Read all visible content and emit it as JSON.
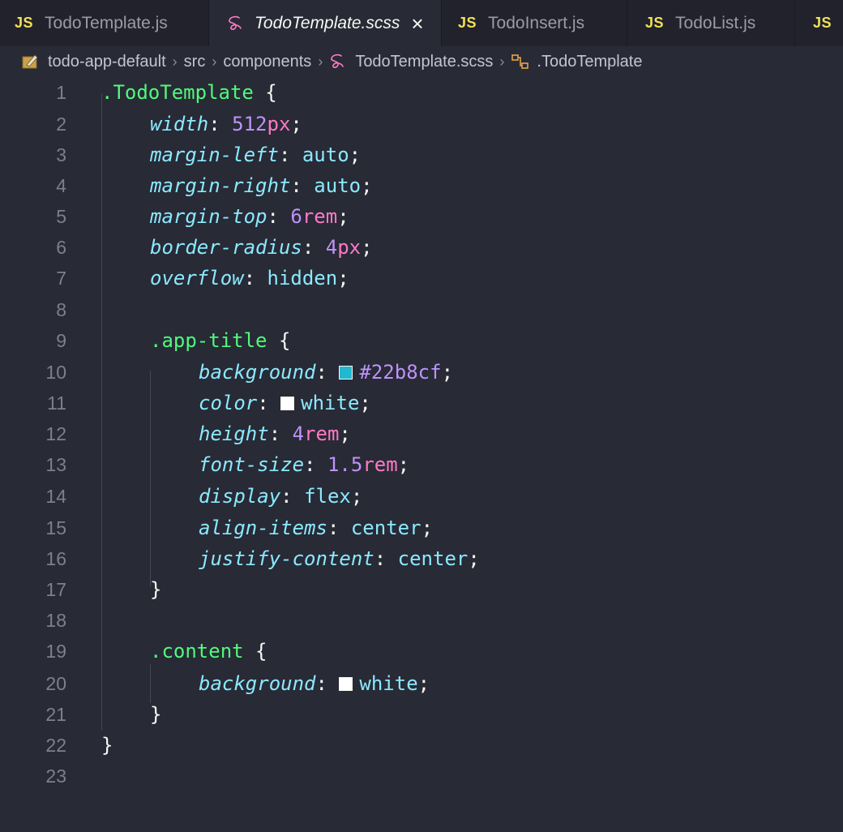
{
  "tabs": [
    {
      "kind": "js",
      "badge": "JS",
      "label": "TodoTemplate.js"
    },
    {
      "kind": "scss",
      "label": "TodoTemplate.scss",
      "close": "×"
    },
    {
      "kind": "js",
      "badge": "JS",
      "label": "TodoInsert.js"
    },
    {
      "kind": "js",
      "badge": "JS",
      "label": "TodoList.js"
    },
    {
      "kind": "js",
      "badge": "JS",
      "label": ""
    }
  ],
  "breadcrumb": [
    "todo-app-default",
    "src",
    "components",
    "TodoTemplate.scss",
    ".TodoTemplate"
  ],
  "colors": {
    "app_title_bg": "#22b8cf",
    "white": "#ffffff"
  },
  "editor": {
    "line_numbers": [
      "1",
      "2",
      "3",
      "4",
      "5",
      "6",
      "7",
      "8",
      "9",
      "10",
      "11",
      "12",
      "13",
      "14",
      "15",
      "16",
      "17",
      "18",
      "19",
      "20",
      "21",
      "22",
      "23"
    ],
    "lines": [
      ".TodoTemplate {",
      "    width: 512px;",
      "    margin-left: auto;",
      "    margin-right: auto;",
      "    margin-top: 6rem;",
      "    border-radius: 4px;",
      "    overflow: hidden;",
      "",
      "    .app-title {",
      "        background: #22b8cf;",
      "        color: white;",
      "        height: 4rem;",
      "        font-size: 1.5rem;",
      "        display: flex;",
      "        align-items: center;",
      "        justify-content: center;",
      "    }",
      "",
      "    .content {",
      "        background: white;",
      "    }",
      "}",
      ""
    ],
    "tokens": {
      "sel_root": ".TodoTemplate",
      "sel_title": ".app-title",
      "sel_content": ".content",
      "p_width": "width",
      "v_width_num": "512",
      "v_width_unit": "px",
      "p_margin_left": "margin-left",
      "v_margin_left": "auto",
      "p_margin_right": "margin-right",
      "v_margin_right": "auto",
      "p_margin_top": "margin-top",
      "v_margin_top_num": "6",
      "v_margin_top_unit": "rem",
      "p_border_radius": "border-radius",
      "v_border_radius_num": "4",
      "v_border_radius_unit": "px",
      "p_overflow": "overflow",
      "v_overflow": "hidden",
      "p_background": "background",
      "v_background_hex": "#22b8cf",
      "p_color": "color",
      "v_color": "white",
      "p_height": "height",
      "v_height_num": "4",
      "v_height_unit": "rem",
      "p_font_size": "font-size",
      "v_font_size_num": "1.5",
      "v_font_size_unit": "rem",
      "p_display": "display",
      "v_display": "flex",
      "p_align_items": "align-items",
      "v_align_items": "center",
      "p_justify_content": "justify-content",
      "v_justify_content": "center",
      "p_content_bg": "background",
      "v_content_bg": "white"
    }
  }
}
